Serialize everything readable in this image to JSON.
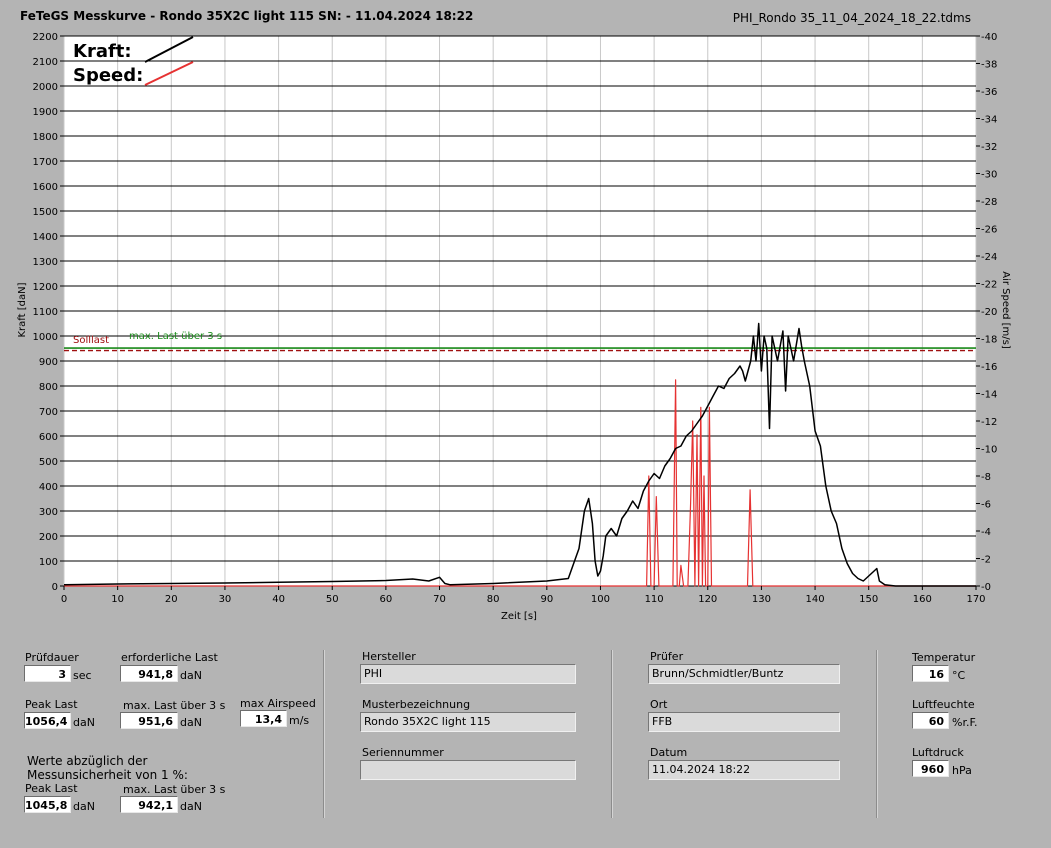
{
  "header": {
    "title": "FeTeGS Messkurve - Rondo 35X2C light 115  SN:  - 11.04.2024 18:22",
    "filename": "PHI_Rondo 35_11_04_2024_18_22.tdms"
  },
  "legend": {
    "kraft_label": "Kraft:",
    "speed_label": "Speed:"
  },
  "colors": {
    "force": "#000000",
    "speed": "#e63232",
    "sollast": "#a01010",
    "maxlast": "#1a8a1a",
    "plot_bg": "#ffffff"
  },
  "chart_data": {
    "type": "line",
    "xlabel": "Zeit [s]",
    "ylabel": "Kraft [daN]",
    "y2label": "Air Speed [m/s]",
    "xlim": [
      0,
      170
    ],
    "ylim": [
      0,
      2200
    ],
    "y2lim": [
      0,
      40
    ],
    "x_ticks": [
      0,
      10,
      20,
      30,
      40,
      50,
      60,
      70,
      80,
      90,
      100,
      110,
      120,
      130,
      140,
      150,
      160,
      170
    ],
    "y_ticks": [
      0,
      100,
      200,
      300,
      400,
      500,
      600,
      700,
      800,
      900,
      1000,
      1100,
      1200,
      1300,
      1400,
      1500,
      1600,
      1700,
      1800,
      1900,
      2000,
      2100,
      2200
    ],
    "y2_ticks": [
      0,
      2,
      4,
      6,
      8,
      10,
      12,
      14,
      16,
      18,
      20,
      22,
      24,
      26,
      28,
      30,
      32,
      34,
      36,
      38,
      40
    ],
    "grid": true,
    "reference_lines": [
      {
        "name": "Solllast",
        "y": 941.8,
        "style": "dashed"
      },
      {
        "name": "max. Last über  3 s",
        "y": 951.6,
        "style": "solid"
      }
    ],
    "series": [
      {
        "name": "Kraft",
        "axis": "left",
        "x": [
          0,
          10,
          20,
          30,
          40,
          50,
          60,
          65,
          68,
          70,
          71,
          72,
          80,
          90,
          94,
          96,
          97,
          97.8,
          98.5,
          99,
          99.5,
          100,
          100.5,
          101,
          102,
          103,
          104,
          105,
          106,
          107,
          108,
          109,
          110,
          111,
          112,
          113,
          114,
          115,
          116,
          117,
          118,
          119,
          120,
          121,
          122,
          123,
          124,
          125,
          126,
          126.5,
          127,
          128,
          128.5,
          129,
          129.5,
          130,
          130.5,
          131,
          131.5,
          132,
          133,
          134,
          134.5,
          135,
          136,
          137,
          137.5,
          138,
          139,
          140,
          141,
          142,
          143,
          144,
          145,
          146,
          147,
          148,
          149,
          150,
          151,
          151.5,
          152,
          153,
          155,
          160,
          170
        ],
        "y": [
          5,
          8,
          10,
          12,
          15,
          18,
          22,
          28,
          20,
          35,
          10,
          5,
          10,
          20,
          30,
          150,
          300,
          350,
          250,
          100,
          40,
          60,
          120,
          200,
          230,
          200,
          270,
          300,
          340,
          310,
          380,
          420,
          450,
          430,
          480,
          510,
          550,
          560,
          600,
          620,
          650,
          680,
          720,
          760,
          800,
          790,
          830,
          850,
          880,
          860,
          820,
          900,
          1000,
          900,
          1050,
          860,
          1000,
          950,
          630,
          1000,
          900,
          1020,
          780,
          1000,
          900,
          1030,
          960,
          900,
          800,
          620,
          560,
          400,
          300,
          250,
          150,
          90,
          50,
          30,
          20,
          40,
          60,
          70,
          20,
          5,
          0,
          0,
          0
        ]
      },
      {
        "name": "Speed",
        "axis": "right",
        "x": [
          0,
          107,
          108.6,
          109,
          109.4,
          110,
          110.4,
          110.9,
          111.3,
          112,
          113.5,
          114,
          114.3,
          114.7,
          115,
          115.5,
          116.3,
          116.8,
          117.2,
          117.6,
          118,
          118.3,
          118.7,
          119,
          119.3,
          119.6,
          120,
          120.3,
          120.7,
          121.3,
          126,
          127.4,
          127.9,
          128.4,
          129,
          170
        ],
        "y": [
          0,
          0,
          0,
          8,
          0,
          0,
          6.5,
          0,
          0,
          0,
          0,
          15,
          0,
          0,
          1.5,
          0,
          0,
          6,
          12,
          0,
          11,
          0,
          13,
          0,
          8,
          0,
          0,
          13,
          0,
          0,
          0,
          0,
          7,
          0,
          0,
          0
        ]
      }
    ]
  },
  "chart_labels": {
    "sollast": "Solllast",
    "maxlast": "max. Last über  3 s"
  },
  "panel1": {
    "pruefdauer_label": "Prüfdauer",
    "pruefdauer_value": "3",
    "pruefdauer_unit": "sec",
    "erf_last_label": "erforderliche Last",
    "erf_last_value": "941,8",
    "erf_last_unit": "daN",
    "peak_last_label": "Peak Last",
    "peak_last_value": "1056,4",
    "peak_last_unit": "daN",
    "max_last_label": "max. Last über  3 s",
    "max_last_value": "951,6",
    "max_last_unit": "daN",
    "max_airspeed_label": "max Airspeed",
    "max_airspeed_value": "13,4",
    "max_airspeed_unit": "m/s",
    "note_line1": "Werte abzüglich der",
    "note_line2": "Messunsicherheit von 1  %:",
    "peak_last2_label": "Peak Last",
    "peak_last2_value": "1045,8",
    "peak_last2_unit": "daN",
    "max_last2_label": "max. Last über  3 s",
    "max_last2_value": "942,1",
    "max_last2_unit": "daN"
  },
  "panel2": {
    "hersteller_label": "Hersteller",
    "hersteller_value": "PHI",
    "muster_label": "Musterbezeichnung",
    "muster_value": "Rondo 35X2C light 115",
    "serien_label": "Seriennummer",
    "serien_value": ""
  },
  "panel3": {
    "pruefer_label": "Prüfer",
    "pruefer_value": "Brunn/Schmidtler/Buntz",
    "ort_label": "Ort",
    "ort_value": "FFB",
    "datum_label": "Datum",
    "datum_value": "11.04.2024 18:22"
  },
  "panel4": {
    "temp_label": "Temperatur",
    "temp_value": "16",
    "temp_unit": "°C",
    "feuchte_label": "Luftfeuchte",
    "feuchte_value": "60",
    "feuchte_unit": "%r.F.",
    "druck_label": "Luftdruck",
    "druck_value": "960",
    "druck_unit": "hPa"
  }
}
